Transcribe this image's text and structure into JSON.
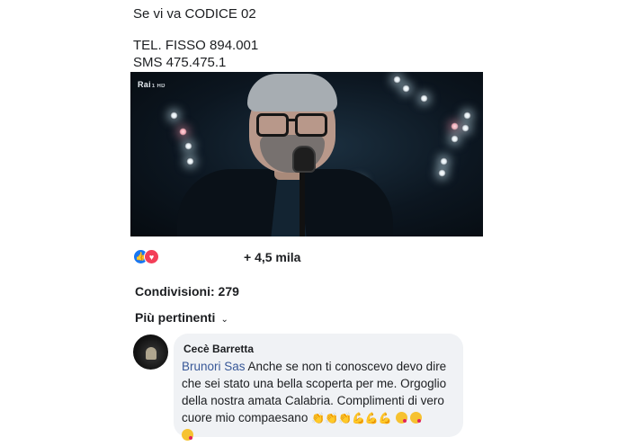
{
  "post": {
    "line1": "Se vi va CODICE 02",
    "line2": "TEL. FISSO 894.001",
    "line3": "SMS 475.475.1"
  },
  "video": {
    "channel_logo": "Rai",
    "channel_sub": "1 HD"
  },
  "reactions": {
    "icons": [
      "like-icon",
      "love-icon"
    ],
    "count": "+ 4,5 mila"
  },
  "shares": "Condivisioni: 279",
  "comments_sort": {
    "label": "Più pertinenti",
    "chevron": "⌄"
  },
  "comment": {
    "author": "Cecè Barretta",
    "mention": "Brunori Sas",
    "text_line1": " Anche se non ti conoscevo devo dire",
    "text_line2": "che sei stato una bella scoperta per me. Orgoglio",
    "text_line3": "della nostra amata Calabria. Complimenti di vero",
    "text_line4": "cuore  mio compaesano ",
    "emojis": [
      "clapping-hands",
      "clapping-hands",
      "clapping-hands",
      "flexed-biceps",
      "flexed-biceps",
      "flexed-biceps",
      "face-blowing-kiss",
      "face-blowing-kiss",
      "face-blowing-kiss"
    ]
  },
  "colors": {
    "mention": "#385898",
    "bubble": "#f0f2f5",
    "like": "#1877f2",
    "love": "#f33e58"
  }
}
